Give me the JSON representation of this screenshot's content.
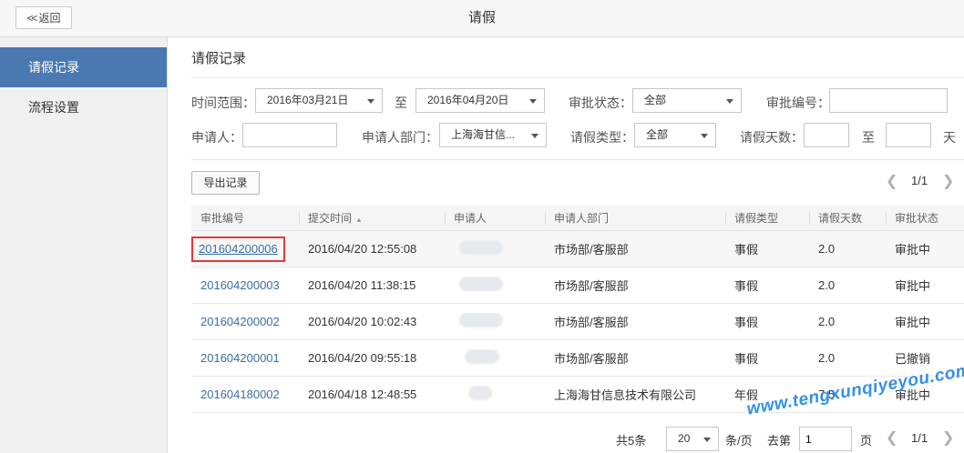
{
  "header": {
    "title": "请假",
    "back_label": "返回"
  },
  "sidebar": {
    "items": [
      {
        "label": "请假记录",
        "active": true
      },
      {
        "label": "流程设置",
        "active": false
      }
    ]
  },
  "section": {
    "title": "请假记录"
  },
  "filters": {
    "time_range_label": "时间范围：",
    "date_from": "2016年03月21日",
    "to_label": "至",
    "date_to": "2016年04月20日",
    "status_label": "审批状态：",
    "status_value": "全部",
    "approval_no_label": "审批编号：",
    "approval_no_value": "",
    "applicant_label": "申请人：",
    "applicant_value": "",
    "dept_label": "申请人部门：",
    "dept_value": "上海海甘信...",
    "leave_type_label": "请假类型：",
    "leave_type_value": "全部",
    "days_label": "请假天数：",
    "days_from": "",
    "days_to_label": "至",
    "days_to": "",
    "days_unit": "天"
  },
  "toolbar": {
    "export_label": "导出记录",
    "page_indicator": "1/1"
  },
  "table": {
    "columns": [
      "审批编号",
      "提交时间",
      "申请人",
      "申请人部门",
      "请假类型",
      "请假天数",
      "审批状态"
    ],
    "rows": [
      {
        "id": "201604200006",
        "time": "2016/04/20 12:55:08",
        "dept": "市场部/客服部",
        "type": "事假",
        "days": "2.0",
        "status": "审批中"
      },
      {
        "id": "201604200003",
        "time": "2016/04/20 11:38:15",
        "dept": "市场部/客服部",
        "type": "事假",
        "days": "2.0",
        "status": "审批中"
      },
      {
        "id": "201604200002",
        "time": "2016/04/20 10:02:43",
        "dept": "市场部/客服部",
        "type": "事假",
        "days": "2.0",
        "status": "审批中"
      },
      {
        "id": "201604200001",
        "time": "2016/04/20 09:55:18",
        "dept": "市场部/客服部",
        "type": "事假",
        "days": "2.0",
        "status": "已撤销"
      },
      {
        "id": "201604180002",
        "time": "2016/04/18 12:48:55",
        "dept": "上海海甘信息技术有限公司",
        "type": "年假",
        "days": "7.5",
        "status": "审批中"
      }
    ]
  },
  "footer": {
    "total": "共5条",
    "page_size": "20",
    "per_page": "条/页",
    "goto_label": "去第",
    "goto_value": "1",
    "page_unit": "页",
    "page_indicator": "1/1"
  },
  "watermark": "www.tengxunqiyeyou.com"
}
